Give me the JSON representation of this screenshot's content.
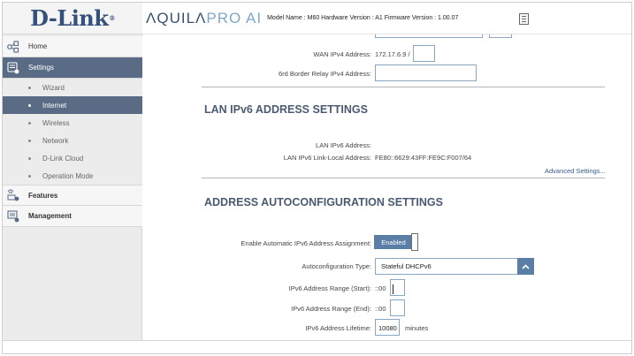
{
  "brand": {
    "logo": "D-Link",
    "logo_reg": "®",
    "product_main": "ΛQUILΛ",
    "product_pro": "PRO",
    "product_ai": "AI",
    "model_info": "Model Name : M60 Hardware Version : A1 Firmware Version : 1.00.07"
  },
  "sidebar": {
    "home": "Home",
    "settings": "Settings",
    "sub_items": [
      "Wizard",
      "Internet",
      "Wireless",
      "Network",
      "D-Link Cloud",
      "Operation Mode"
    ],
    "features": "Features",
    "management": "Management"
  },
  "wan": {
    "ipv4_label": "WAN IPv4 Address:",
    "ipv4_value": "172.17.6.9 /",
    "relay_label": "6rd Border Relay IPv4 Address:"
  },
  "lan": {
    "title": "LAN IPv6 ADDRESS SETTINGS",
    "address_label": "LAN IPv6 Address:",
    "link_local_label": "LAN IPv6 Link-Local Address:",
    "link_local_value": "FE80::6629:43FF:FE9C:F007/64",
    "advanced": "Advanced Settings..."
  },
  "autoconf": {
    "title": "ADDRESS AUTOCONFIGURATION SETTINGS",
    "enable_label": "Enable Automatic IPv6 Address Assignment:",
    "enable_state": "Enabled",
    "type_label": "Autoconfiguration Type:",
    "type_value": "Stateful DHCPv6",
    "range_start_label": "IPv6 Address Range (Start):",
    "range_start_prefix": "::00",
    "range_end_label": "IPv6 Address Range (End):",
    "range_end_prefix": "::00",
    "lifetime_label": "IPv6 Address Lifetime:",
    "lifetime_value": "10080",
    "lifetime_unit": "minutes"
  },
  "colors": {
    "sidebar_active": "#5a6c85",
    "accent": "#5b7ea6",
    "title": "#4a5a70"
  }
}
